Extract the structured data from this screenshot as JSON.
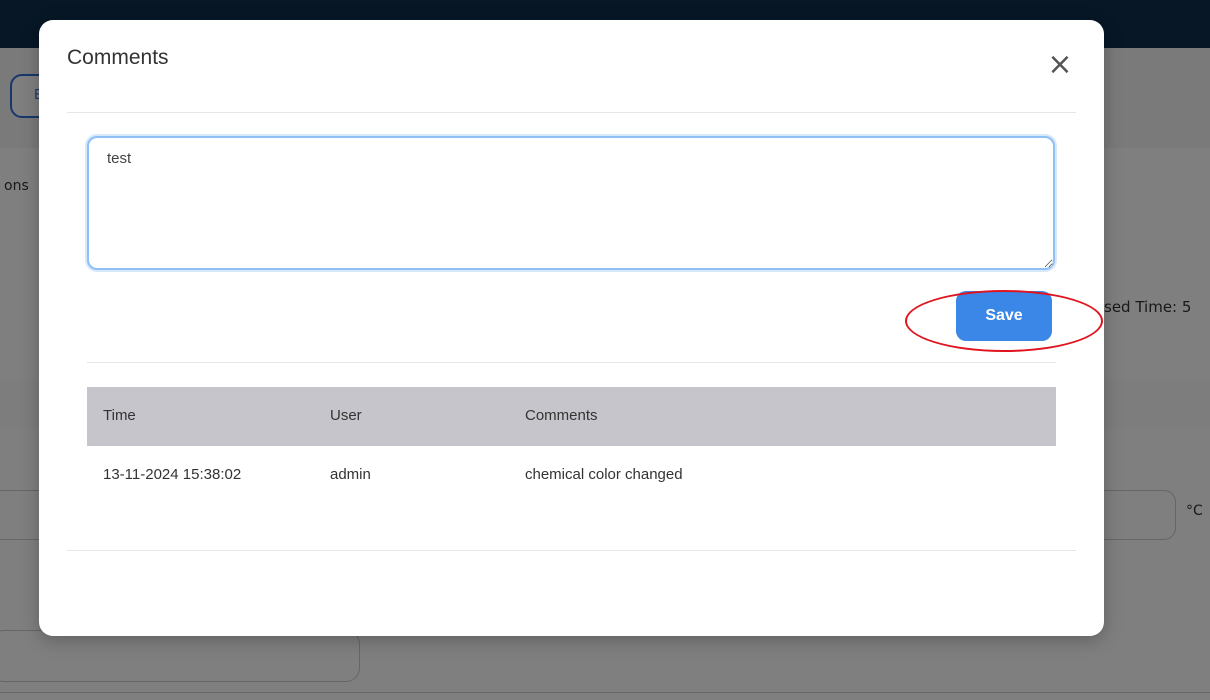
{
  "background": {
    "outline_button_label": "E",
    "tab_fragment": "ons",
    "elapsed_fragment": "sed Time: 5",
    "unit_label": "°C"
  },
  "modal": {
    "title": "Comments",
    "close_icon": "close-icon",
    "comment_value": "test",
    "save_label": "Save",
    "table": {
      "headers": [
        "Time",
        "User",
        "Comments"
      ],
      "rows": [
        [
          "13-11-2024 15:38:02",
          "admin",
          "chemical color changed"
        ]
      ]
    }
  },
  "colors": {
    "accent": "#3a87e8",
    "highlight_ring": "#e0141e",
    "header_row": "#c6c5cb",
    "topbar": "#0f2f4c"
  }
}
